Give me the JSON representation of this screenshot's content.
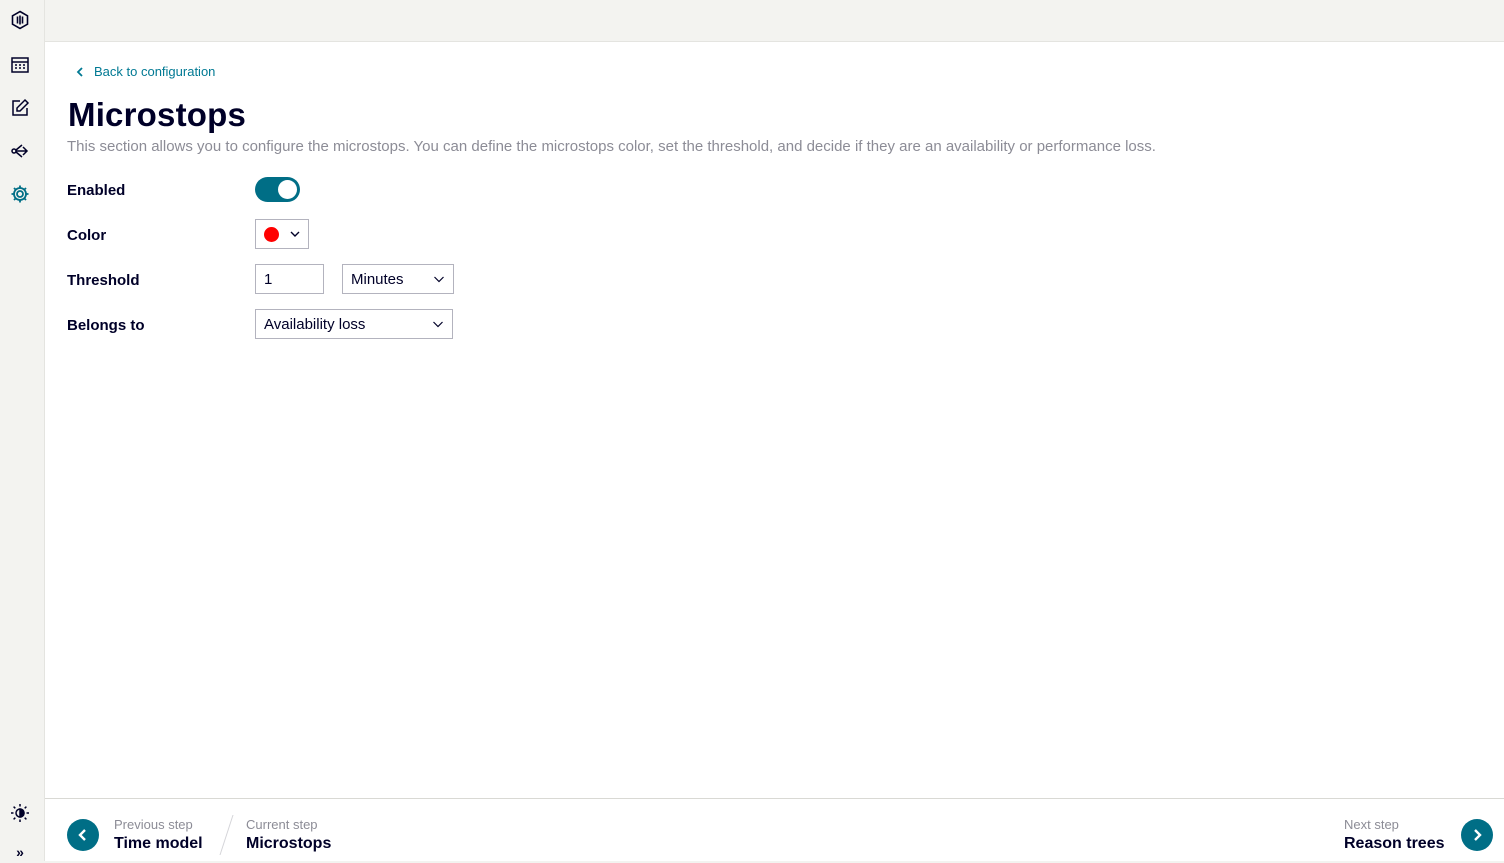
{
  "sidebar": {
    "items": [
      {
        "icon": "app-logo-icon"
      },
      {
        "icon": "calendar-icon"
      },
      {
        "icon": "edit-icon"
      },
      {
        "icon": "share-icon"
      },
      {
        "icon": "gear-icon",
        "active": true
      }
    ],
    "bottom": [
      {
        "icon": "theme-brightness-icon"
      },
      {
        "icon": "expand-chevrons-icon",
        "label": "»"
      }
    ]
  },
  "main": {
    "back_label": "Back to configuration",
    "title": "Microstops",
    "description": "This section allows you to configure the microstops. You can define the microstops color, set the threshold, and decide if they are an availability or performance loss.",
    "form": {
      "enabled_label": "Enabled",
      "enabled_value": true,
      "color_label": "Color",
      "color_value": "#ff0000",
      "threshold_label": "Threshold",
      "threshold_value": "1",
      "threshold_unit": "Minutes",
      "belongs_label": "Belongs to",
      "belongs_value": "Availability loss"
    }
  },
  "footer": {
    "previous_caption": "Previous step",
    "previous_name": "Time model",
    "current_caption": "Current step",
    "current_name": "Microstops",
    "next_caption": "Next step",
    "next_name": "Reason trees"
  },
  "colors": {
    "accent": "#006e86",
    "link": "#007993",
    "text": "#000028",
    "muted": "#8c8c96"
  }
}
